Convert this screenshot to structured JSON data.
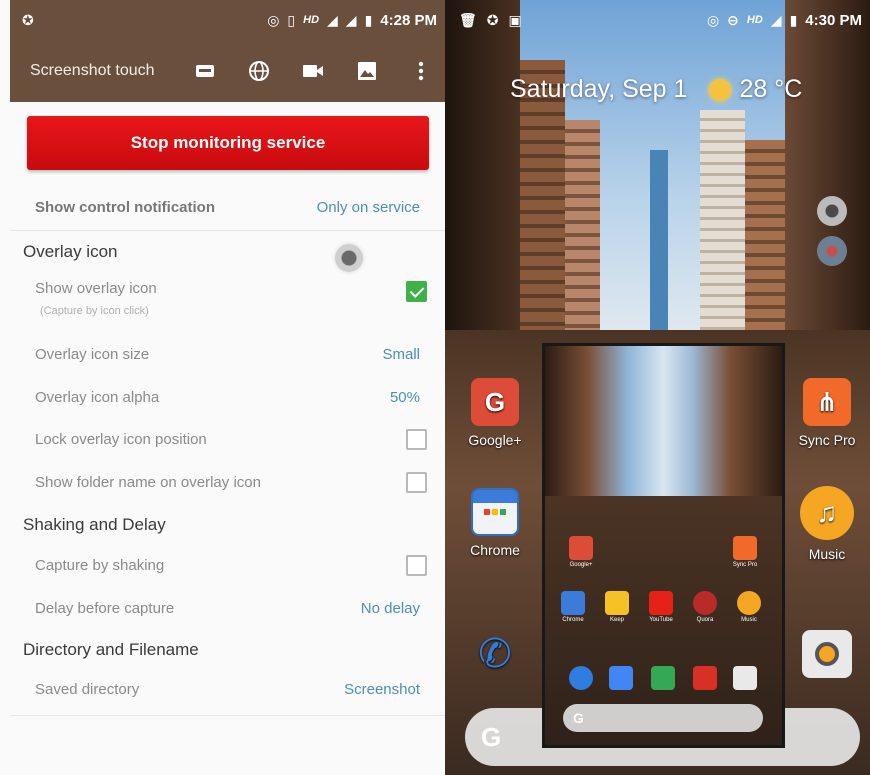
{
  "left": {
    "status_bar": {
      "time": "4:28 PM",
      "hd": "HD"
    },
    "toolbar": {
      "title": "Screenshot touch",
      "actions": [
        "video-card-icon",
        "globe-icon",
        "videocam-icon",
        "image-icon",
        "more-vert-icon"
      ]
    },
    "stop_button": "Stop monitoring service",
    "control_notification": {
      "label": "Show control notification",
      "value": "Only on service"
    },
    "overlay_section": {
      "title": "Overlay icon",
      "show_icon": {
        "label": "Show overlay icon",
        "sub": "(Capture by icon click)",
        "checked": true
      },
      "size": {
        "label": "Overlay icon size",
        "value": "Small"
      },
      "alpha": {
        "label": "Overlay icon alpha",
        "value": "50%"
      },
      "lock": {
        "label": "Lock overlay icon position",
        "checked": false
      },
      "folder": {
        "label": "Show folder name on overlay icon",
        "checked": false
      }
    },
    "shaking_section": {
      "title": "Shaking and Delay",
      "shaking": {
        "label": "Capture by shaking",
        "checked": false
      },
      "delay": {
        "label": "Delay before capture",
        "value": "No delay"
      }
    },
    "directory_section": {
      "title": "Directory and Filename",
      "saved": {
        "label": "Saved directory",
        "value": "Screenshot"
      }
    },
    "colors": {
      "toolbar": "#6b4f3d",
      "accent_red": "#d91013",
      "value_blue": "#4d8fb0",
      "check_green": "#3fb04a"
    }
  },
  "right": {
    "status_bar": {
      "time": "4:30 PM",
      "hd": "HD"
    },
    "date_widget": {
      "date": "Saturday, Sep 1",
      "temp": "28 °C"
    },
    "apps": {
      "google_plus": "Google+",
      "sync_pro": "Sync Pro",
      "chrome": "Chrome",
      "music": "Music"
    },
    "search_g": "G",
    "thumbnail": {
      "apps_row1": [
        "Google+",
        "Sync Pro"
      ],
      "apps_row2": [
        "Chrome",
        "Keep",
        "YouTube",
        "Quora",
        "Music"
      ]
    }
  }
}
